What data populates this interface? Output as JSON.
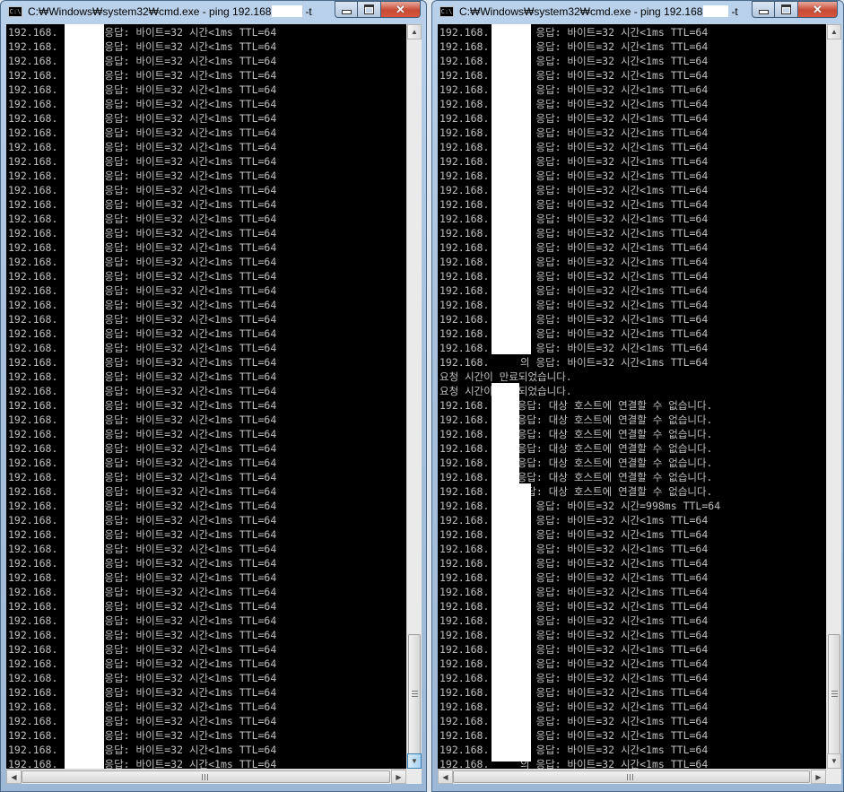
{
  "windows": {
    "left": {
      "title_prefix": "C:₩Windows₩system32₩cmd.exe - ping  192.168",
      "title_suffix": "-t",
      "icon_text": "C:\\",
      "lines": [
        "192.168.     의 응답: 바이트=32 시간<1ms TTL=64",
        "192.168.     의 응답: 바이트=32 시간<1ms TTL=64",
        "192.168.     의 응답: 바이트=32 시간<1ms TTL=64",
        "192.168.     의 응답: 바이트=32 시간<1ms TTL=64",
        "192.168.     의 응답: 바이트=32 시간<1ms TTL=64",
        "192.168.     의 응답: 바이트=32 시간<1ms TTL=64",
        "192.168.     의 응답: 바이트=32 시간<1ms TTL=64",
        "192.168.     의 응답: 바이트=32 시간<1ms TTL=64",
        "192.168.     의 응답: 바이트=32 시간<1ms TTL=64",
        "192.168.     의 응답: 바이트=32 시간<1ms TTL=64",
        "192.168.     의 응답: 바이트=32 시간<1ms TTL=64",
        "192.168.     의 응답: 바이트=32 시간<1ms TTL=64",
        "192.168.     의 응답: 바이트=32 시간<1ms TTL=64",
        "192.168.     의 응답: 바이트=32 시간<1ms TTL=64",
        "192.168.     의 응답: 바이트=32 시간<1ms TTL=64",
        "192.168.     의 응답: 바이트=32 시간<1ms TTL=64",
        "192.168.     의 응답: 바이트=32 시간<1ms TTL=64",
        "192.168.     의 응답: 바이트=32 시간<1ms TTL=64",
        "192.168.     의 응답: 바이트=32 시간<1ms TTL=64",
        "192.168.     의 응답: 바이트=32 시간<1ms TTL=64",
        "192.168.     의 응답: 바이트=32 시간<1ms TTL=64",
        "192.168.     의 응답: 바이트=32 시간<1ms TTL=64",
        "192.168.     의 응답: 바이트=32 시간<1ms TTL=64",
        "192.168.     의 응답: 바이트=32 시간<1ms TTL=64",
        "192.168.     의 응답: 바이트=32 시간<1ms TTL=64",
        "192.168.     의 응답: 바이트=32 시간<1ms TTL=64",
        "192.168.     의 응답: 바이트=32 시간<1ms TTL=64",
        "192.168.     의 응답: 바이트=32 시간<1ms TTL=64",
        "192.168.     의 응답: 바이트=32 시간<1ms TTL=64",
        "192.168.     의 응답: 바이트=32 시간<1ms TTL=64",
        "192.168.     의 응답: 바이트=32 시간<1ms TTL=64",
        "192.168.     의 응답: 바이트=32 시간<1ms TTL=64",
        "192.168.     의 응답: 바이트=32 시간<1ms TTL=64",
        "192.168.     의 응답: 바이트=32 시간<1ms TTL=64",
        "192.168.     의 응답: 바이트=32 시간<1ms TTL=64",
        "192.168.     의 응답: 바이트=32 시간<1ms TTL=64",
        "192.168.     의 응답: 바이트=32 시간<1ms TTL=64",
        "192.168.     의 응답: 바이트=32 시간<1ms TTL=64",
        "192.168.     의 응답: 바이트=32 시간<1ms TTL=64",
        "192.168.     의 응답: 바이트=32 시간<1ms TTL=64",
        "192.168.     의 응답: 바이트=32 시간<1ms TTL=64",
        "192.168.     의 응답: 바이트=32 시간<1ms TTL=64",
        "192.168.     의 응답: 바이트=32 시간<1ms TTL=64",
        "192.168.     의 응답: 바이트=32 시간<1ms TTL=64",
        "192.168.     의 응답: 바이트=32 시간<1ms TTL=64",
        "192.168.     의 응답: 바이트=32 시간<1ms TTL=64",
        "192.168.     의 응답: 바이트=32 시간<1ms TTL=64",
        "192.168.     의 응답: 바이트=32 시간<1ms TTL=64",
        "192.168.     의 응답: 바이트=32 시간<1ms TTL=64",
        "192.168.     의 응답: 바이트=32 시간<1ms TTL=64",
        "192.168.     의 응답: 바이트=32 시간<1ms TTL=64",
        "192.168.     의 응답: 바이트=32 시간<1ms TTL=64",
        "192.168.     의 응답: 바이트=32 시간<1ms TTL=64"
      ]
    },
    "right": {
      "title_prefix": "C:₩Windows₩system32₩cmd.exe - ping  192.168",
      "title_suffix": "-t",
      "icon_text": "C:\\",
      "lines": [
        "192.168.     의 응답: 바이트=32 시간<1ms TTL=64",
        "192.168.     의 응답: 바이트=32 시간<1ms TTL=64",
        "192.168.     의 응답: 바이트=32 시간<1ms TTL=64",
        "192.168.     의 응답: 바이트=32 시간<1ms TTL=64",
        "192.168.     의 응답: 바이트=32 시간<1ms TTL=64",
        "192.168.     의 응답: 바이트=32 시간<1ms TTL=64",
        "192.168.     의 응답: 바이트=32 시간<1ms TTL=64",
        "192.168.     의 응답: 바이트=32 시간<1ms TTL=64",
        "192.168.     의 응답: 바이트=32 시간<1ms TTL=64",
        "192.168.     의 응답: 바이트=32 시간<1ms TTL=64",
        "192.168.     의 응답: 바이트=32 시간<1ms TTL=64",
        "192.168.     의 응답: 바이트=32 시간<1ms TTL=64",
        "192.168.     의 응답: 바이트=32 시간<1ms TTL=64",
        "192.168.     의 응답: 바이트=32 시간<1ms TTL=64",
        "192.168.     의 응답: 바이트=32 시간<1ms TTL=64",
        "192.168.     의 응답: 바이트=32 시간<1ms TTL=64",
        "192.168.     의 응답: 바이트=32 시간<1ms TTL=64",
        "192.168.     의 응답: 바이트=32 시간<1ms TTL=64",
        "192.168.     의 응답: 바이트=32 시간<1ms TTL=64",
        "192.168.     의 응답: 바이트=32 시간<1ms TTL=64",
        "192.168.     의 응답: 바이트=32 시간<1ms TTL=64",
        "192.168.     의 응답: 바이트=32 시간<1ms TTL=64",
        "192.168.     의 응답: 바이트=32 시간<1ms TTL=64",
        "192.168.     의 응답: 바이트=32 시간<1ms TTL=64",
        "요청 시간이 만료되었습니다.",
        "요청 시간이 만료되었습니다.",
        "192.168.  의 응답: 대상 호스트에 연결할 수 없습니다.",
        "192.168.  의 응답: 대상 호스트에 연결할 수 없습니다.",
        "192.168.  의 응답: 대상 호스트에 연결할 수 없습니다.",
        "192.168.  의 응답: 대상 호스트에 연결할 수 없습니다.",
        "192.168.  의 응답: 대상 호스트에 연결할 수 없습니다.",
        "192.168.  의 응답: 대상 호스트에 연결할 수 없습니다.",
        "192.168.  의 응답: 대상 호스트에 연결할 수 없습니다.",
        "192.168.     의 응답: 바이트=32 시간=998ms TTL=64",
        "192.168.     의 응답: 바이트=32 시간<1ms TTL=64",
        "192.168.     의 응답: 바이트=32 시간<1ms TTL=64",
        "192.168.     의 응답: 바이트=32 시간<1ms TTL=64",
        "192.168.     의 응답: 바이트=32 시간<1ms TTL=64",
        "192.168.     의 응답: 바이트=32 시간<1ms TTL=64",
        "192.168.     의 응답: 바이트=32 시간<1ms TTL=64",
        "192.168.     의 응답: 바이트=32 시간<1ms TTL=64",
        "192.168.     의 응답: 바이트=32 시간<1ms TTL=64",
        "192.168.     의 응답: 바이트=32 시간<1ms TTL=64",
        "192.168.     의 응답: 바이트=32 시간<1ms TTL=64",
        "192.168.     의 응답: 바이트=32 시간<1ms TTL=64",
        "192.168.     의 응답: 바이트=32 시간<1ms TTL=64",
        "192.168.     의 응답: 바이트=32 시간<1ms TTL=64",
        "192.168.     의 응답: 바이트=32 시간<1ms TTL=64",
        "192.168.     의 응답: 바이트=32 시간<1ms TTL=64",
        "192.168.     의 응답: 바이트=32 시간<1ms TTL=64",
        "192.168.     의 응답: 바이트=32 시간<1ms TTL=64",
        "192.168.     의 응답: 바이트=32 시간<1ms TTL=64",
        "192.168.     의 응답: 바이트=32 시간<1ms TTL=64"
      ]
    }
  },
  "controls": {
    "close_glyph": "✕"
  },
  "scrollbar_glyphs": {
    "up": "▲",
    "down": "▼",
    "left": "◀",
    "right": "▶"
  },
  "colors": {
    "console_bg": "#000000",
    "console_text": "#c0c0c0"
  }
}
